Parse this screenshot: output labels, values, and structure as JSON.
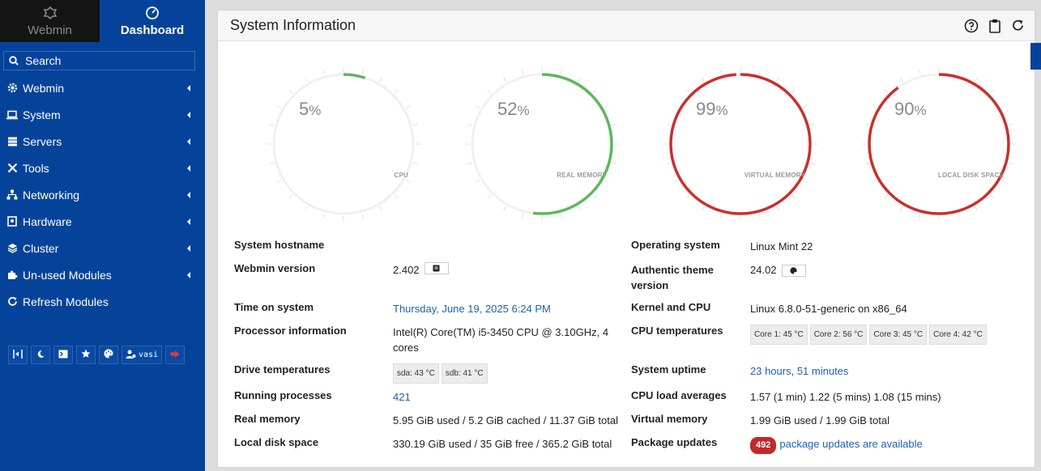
{
  "sidebar": {
    "tabs": [
      {
        "label": "Webmin",
        "icon": "webmin-logo-icon"
      },
      {
        "label": "Dashboard",
        "icon": "dashboard-gauge-icon"
      }
    ],
    "search_label": "Search",
    "menu": [
      {
        "label": "Webmin",
        "icon": "gear-icon"
      },
      {
        "label": "System",
        "icon": "laptop-icon"
      },
      {
        "label": "Servers",
        "icon": "server-icon"
      },
      {
        "label": "Tools",
        "icon": "tools-icon"
      },
      {
        "label": "Networking",
        "icon": "network-icon"
      },
      {
        "label": "Hardware",
        "icon": "hard-drive-icon"
      },
      {
        "label": "Cluster",
        "icon": "layers-icon"
      },
      {
        "label": "Un-used Modules",
        "icon": "puzzle-icon"
      },
      {
        "label": "Refresh Modules",
        "icon": "refresh-icon"
      }
    ],
    "toolbar_user": "vasi"
  },
  "panel": {
    "title": "System Information"
  },
  "gauges": [
    {
      "value": "5",
      "unit": "%",
      "fraction": 0.05,
      "label": "CPU",
      "color": "#5cb85c"
    },
    {
      "value": "52",
      "unit": "%",
      "fraction": 0.52,
      "label": "REAL MEMORY",
      "color": "#5cb85c"
    },
    {
      "value": "99",
      "unit": "%",
      "fraction": 0.99,
      "label": "VIRTUAL MEMORY",
      "color": "#c9302c"
    },
    {
      "value": "90",
      "unit": "%",
      "fraction": 0.9,
      "label": "LOCAL DISK SPACE",
      "color": "#c9302c"
    }
  ],
  "info": {
    "hostname_label": "System hostname",
    "os_label": "Operating system",
    "os_value": "Linux Mint 22",
    "webmin_version_label": "Webmin version",
    "webmin_version_value": "2.402",
    "theme_label_1": "Authentic theme",
    "theme_label_2": "version",
    "theme_value": "24.02",
    "time_label": "Time on system",
    "time_value": "Thursday, June 19, 2025 6:24 PM",
    "kernel_label": "Kernel and CPU",
    "kernel_value": "Linux 6.8.0-51-generic on x86_64",
    "processor_label": "Processor information",
    "processor_value_1": "Intel(R) Core(TM) i5-3450 CPU @ 3.10GHz, 4",
    "processor_value_2": "cores",
    "cpu_temp_label": "CPU temperatures",
    "cpu_temps": [
      "Core 1: 45 °C",
      "Core 2: 56 °C",
      "Core 3: 45 °C",
      "Core 4: 42 °C"
    ],
    "drive_temp_label": "Drive temperatures",
    "drive_temps": [
      "sda: 43 °C",
      "sdb: 41 °C"
    ],
    "uptime_label": "System uptime",
    "uptime_value": "23 hours, 51 minutes",
    "processes_label": "Running processes",
    "processes_value": "421",
    "load_label": "CPU load averages",
    "load_value": "1.57 (1 min) 1.22 (5 mins) 1.08 (15 mins)",
    "real_mem_label": "Real memory",
    "real_mem_value": "5.95 GiB used / 5.2 GiB cached / 11.37 GiB total",
    "virt_mem_label": "Virtual memory",
    "virt_mem_value": "1.99 GiB used / 1.99 GiB total",
    "disk_label": "Local disk space",
    "disk_value": "330.19 GiB used / 35 GiB free / 365.2 GiB total",
    "updates_label": "Package updates",
    "updates_count": "492",
    "updates_text": "package updates are available"
  }
}
